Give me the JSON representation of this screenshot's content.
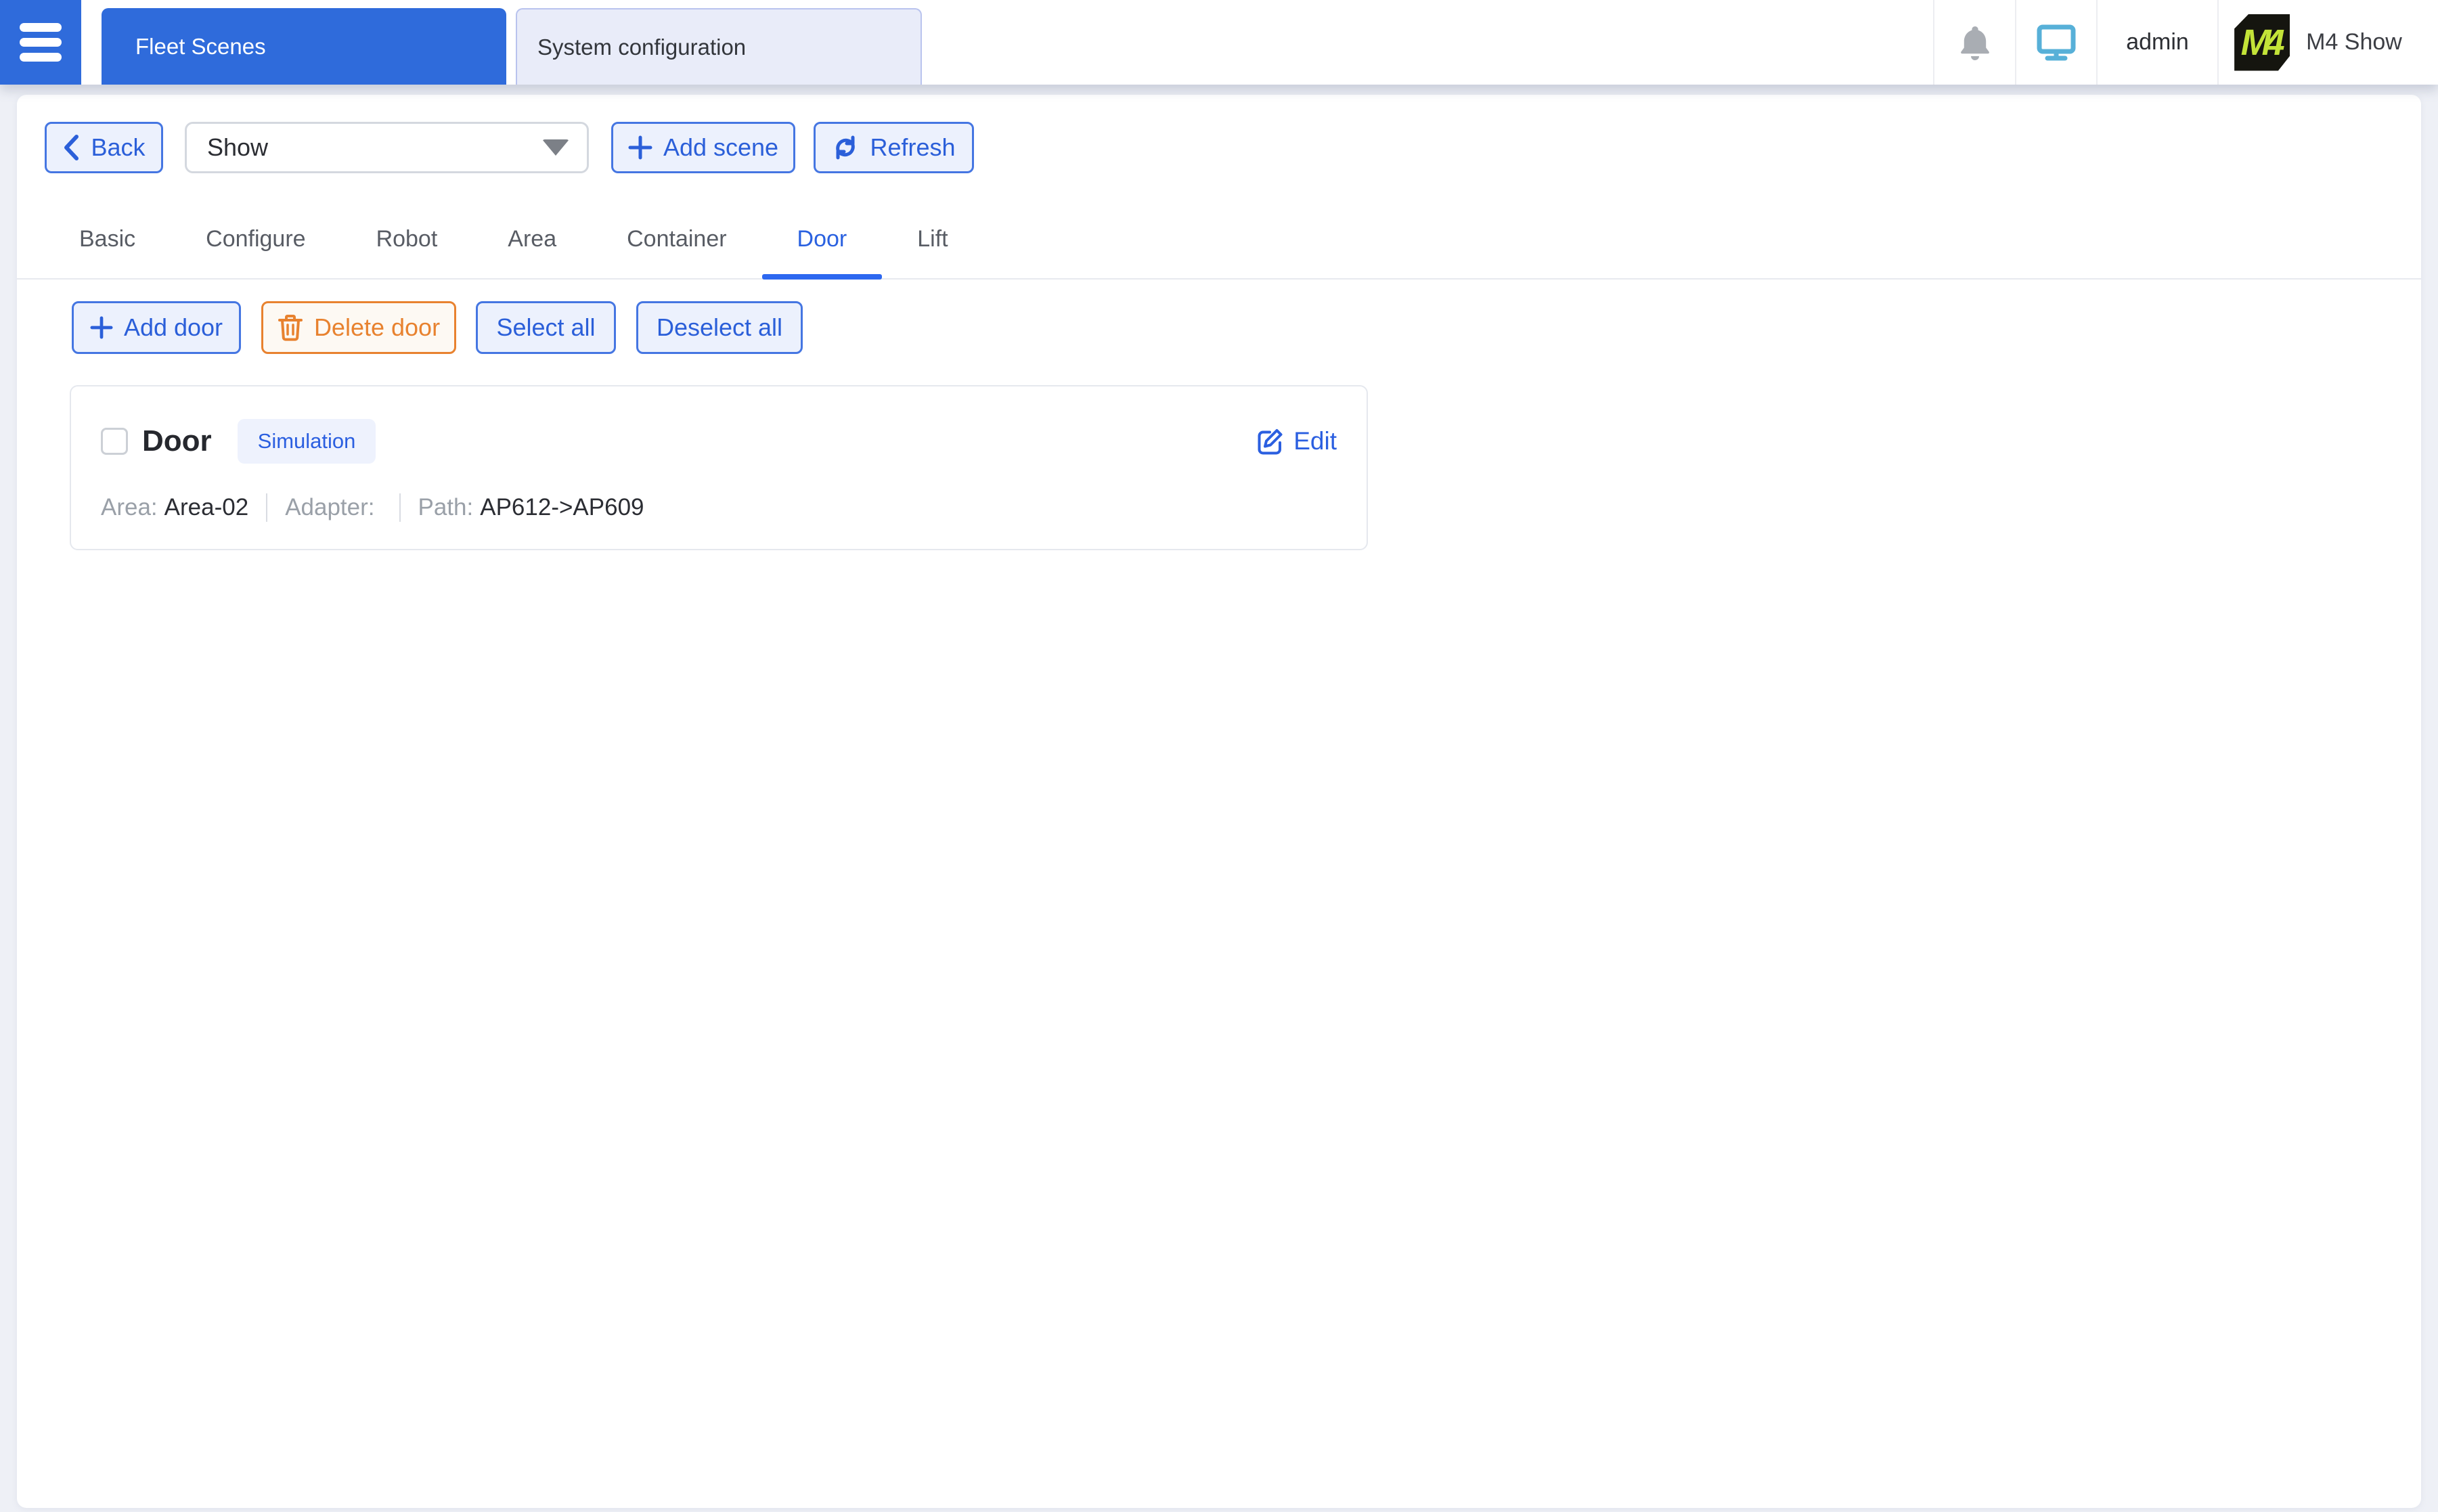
{
  "topbar": {
    "tabs": [
      {
        "label": "Fleet Scenes"
      },
      {
        "label": "System configuration"
      }
    ],
    "user": "admin",
    "brand": {
      "logo_text": "M4",
      "name": "M4 Show"
    }
  },
  "toolbar": {
    "back_label": "Back",
    "scene_select_value": "Show",
    "add_scene_label": "Add scene",
    "refresh_label": "Refresh"
  },
  "nav_tabs": [
    {
      "label": "Basic"
    },
    {
      "label": "Configure"
    },
    {
      "label": "Robot"
    },
    {
      "label": "Area"
    },
    {
      "label": "Container"
    },
    {
      "label": "Door",
      "active": true
    },
    {
      "label": "Lift"
    }
  ],
  "actions": {
    "add_door_label": "Add door",
    "delete_door_label": "Delete door",
    "select_all_label": "Select all",
    "deselect_all_label": "Deselect all"
  },
  "door_card": {
    "title": "Door",
    "badge": "Simulation",
    "edit_label": "Edit",
    "area_label": "Area:",
    "area_value": "Area-02",
    "adapter_label": "Adapter:",
    "adapter_value": "",
    "path_label": "Path:",
    "path_value": "AP612->AP609"
  },
  "colors": {
    "primary_blue": "#2f6bdb",
    "button_blue": "#2b5fd9",
    "button_blue_bg": "#ecf1fd",
    "orange": "#e8822f",
    "badge_bg": "#eef2fd",
    "monitor_icon_blue": "#57b0d8",
    "bell_gray": "#a9adb3",
    "logo_lime": "#c3e338",
    "page_bg": "#eef0f6"
  }
}
